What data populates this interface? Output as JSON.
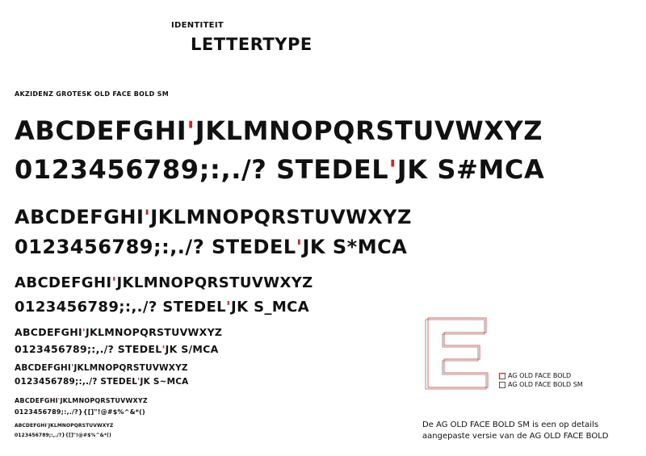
{
  "header": {
    "section": "IDENTITEIT",
    "title": "LETTERTYPE"
  },
  "font_name": "AKZIDENZ GROTESK OLD FACE BOLD SM",
  "rows": {
    "r1": {
      "alpha_a": "ABCDEFGHI",
      "alpha_b": "JKLMNOPQRSTUVWXYZ",
      "num": "0123456789;:,./? STEDEL",
      "num_b": "JK S#MCA"
    },
    "r2": {
      "alpha_a": "ABCDEFGHI",
      "alpha_b": "JKLMNOPQRSTUVWXYZ",
      "num": "0123456789;:,./? STEDEL",
      "num_b": "JK S*MCA"
    },
    "r3": {
      "alpha_a": "ABCDEFGHI",
      "alpha_b": "JKLMNOPQRSTUVWXYZ",
      "num": "0123456789;:,./? STEDEL",
      "num_b": "JK S_MCA"
    },
    "r4": {
      "alpha_a": "ABCDEFGHI",
      "alpha_b": "JKLMNOPQRSTUVWXYZ",
      "num": "0123456789;:,./? STEDEL",
      "num_b": "JK S/MCA"
    },
    "r5": {
      "alpha_a": "ABCDEFGHI",
      "alpha_b": "JKLMNOPQRSTUVWXYZ",
      "num": "0123456789;:,./? STEDEL",
      "num_b": "JK S~MCA"
    },
    "r6": {
      "alpha_a": "ABCDEFGHI",
      "alpha_b": "JKLMNOPQRSTUVWXYZ",
      "num": "0123456789;:,./?}{[]\"!@#$%^&*()"
    },
    "r7": {
      "alpha_a": "ABCDEFGHI",
      "alpha_b": "JKLMNOPQRSTUVWXYZ",
      "num": "0123456789;:,./?}{[]\"!@#$%^&*()"
    }
  },
  "red_mark": "'",
  "legend": {
    "item1": "AG OLD FACE BOLD",
    "item2": "AG OLD FACE BOLD SM"
  },
  "note": {
    "line1": "De AG OLD FACE BOLD SM is een op details",
    "line2": "aangepaste versie van de AG OLD FACE BOLD"
  },
  "colors": {
    "accent_red": "#e02020",
    "ink": "#111111"
  }
}
